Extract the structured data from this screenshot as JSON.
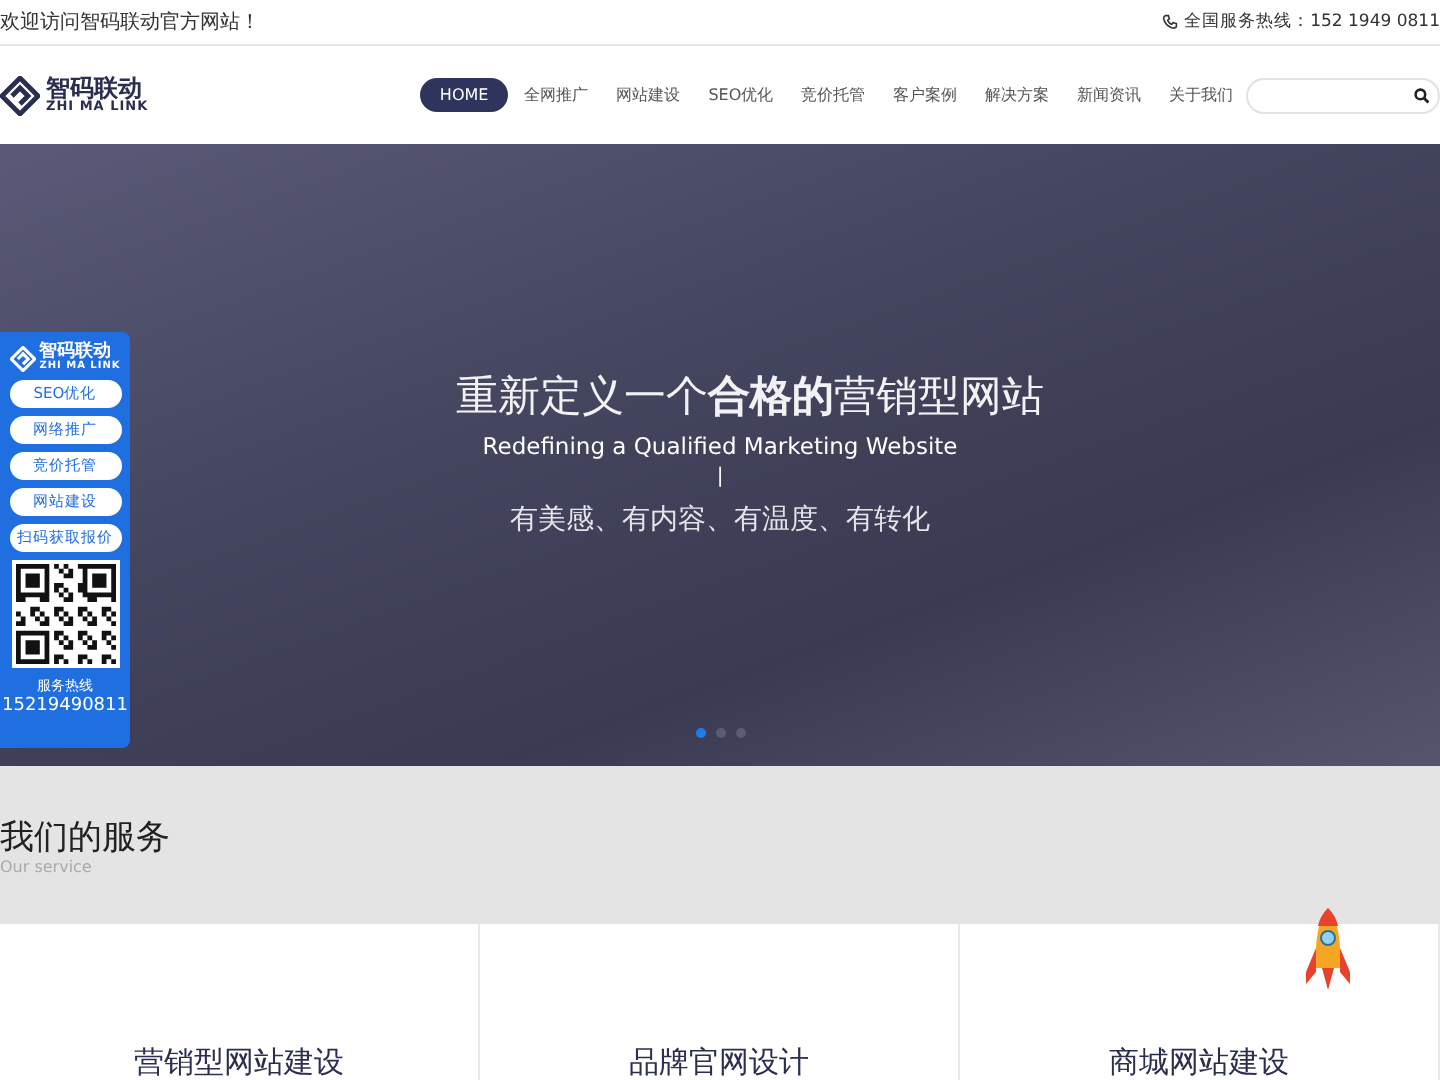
{
  "top_bar": {
    "welcome": "欢迎访问智码联动官方网站！",
    "hotline": "全国服务热线：152 1949 0811"
  },
  "header": {
    "logo": {
      "name": "智码联动",
      "sub": "ZHI MA LINK"
    },
    "nav": [
      {
        "label": "HOME",
        "selected": true
      },
      {
        "label": "全网推广",
        "selected": false
      },
      {
        "label": "网站建设",
        "selected": false
      },
      {
        "label": "SEO优化",
        "selected": false
      },
      {
        "label": "竞价托管",
        "selected": false
      },
      {
        "label": "客户案例",
        "selected": false
      },
      {
        "label": "解决方案",
        "selected": false
      },
      {
        "label": "新闻资讯",
        "selected": false
      },
      {
        "label": "关于我们",
        "selected": false
      }
    ]
  },
  "hero": {
    "title": "重新定义一个**合格的**营销型网站",
    "subtitle": "Redefining a Qualified Marketing Website",
    "divider": "|",
    "tagline": "有美感、有内容、有温度、有转化",
    "dots": [
      {
        "selected": true
      },
      {
        "selected": false
      },
      {
        "selected": false
      }
    ]
  },
  "side_panel": {
    "logo": {
      "name": "智码联动",
      "sub": "ZHI MA LINK"
    },
    "buttons": [
      "SEO优化",
      "网络推广",
      "竞价托管",
      "网站建设",
      "扫码获取报价"
    ],
    "hotline_label": "服务热线",
    "hotline": "15219490811"
  },
  "services": {
    "title": "我们的服务",
    "subtitle": "Our service",
    "cards": [
      {
        "title": "营销型网站建设"
      },
      {
        "title": "品牌官网设计"
      },
      {
        "title": "商城网站建设"
      }
    ]
  }
}
